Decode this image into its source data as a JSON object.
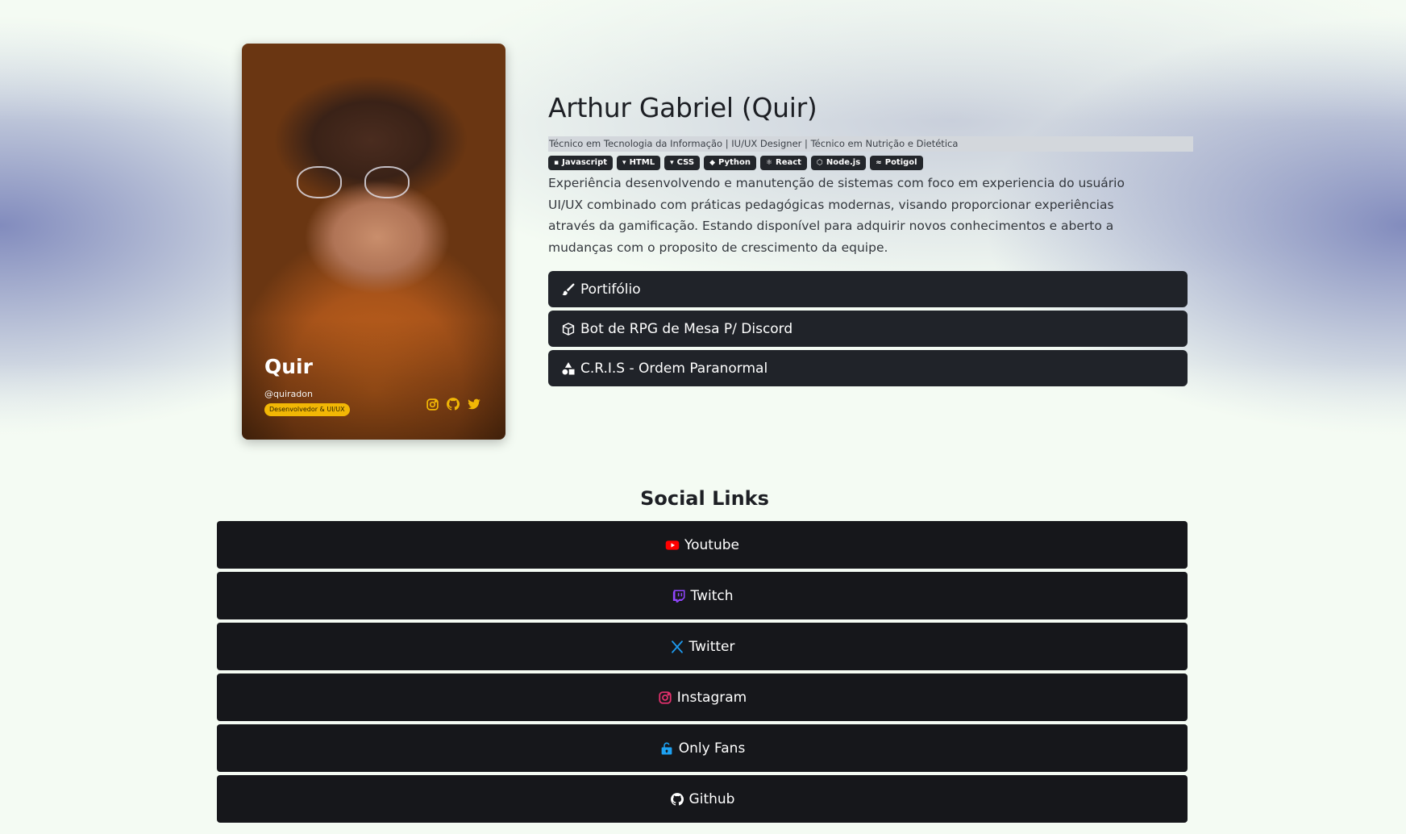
{
  "profile_card": {
    "name": "Quir",
    "handle": "@quiradon",
    "badge": "Desenvolvedor & UI/UX",
    "accent_color": "#f2b705",
    "socials": [
      {
        "icon": "instagram-icon"
      },
      {
        "icon": "github-icon"
      },
      {
        "icon": "twitter-icon"
      }
    ]
  },
  "header": {
    "title": "Arthur Gabriel (Quir)",
    "subtitle": "Técnico em Tecnologia da Informação | IU/UX Designer | Técnico em Nutrição e Dietética"
  },
  "skills": [
    {
      "label": "Javascript",
      "icon": "javascript-icon"
    },
    {
      "label": "HTML",
      "icon": "html-icon"
    },
    {
      "label": "CSS",
      "icon": "css-icon"
    },
    {
      "label": "Python",
      "icon": "python-icon"
    },
    {
      "label": "React",
      "icon": "react-icon"
    },
    {
      "label": "Node.js",
      "icon": "nodejs-icon"
    },
    {
      "label": "Potigol",
      "icon": "potigol-icon"
    }
  ],
  "description": "Experiência desenvolvendo e manutenção de sistemas com foco em experiencia do usuário UI/UX combinado com práticas pedagógicas modernas, visando proporcionar experiências através da gamificação. Estando disponível para adquirir novos conhecimentos e aberto a mudanças com o proposito de crescimento da equipe.",
  "projects": [
    {
      "label": "Portifólio",
      "icon": "brush-icon"
    },
    {
      "label": "Bot de RPG de Mesa P/ Discord",
      "icon": "cube-icon"
    },
    {
      "label": "C.R.I.S - Ordem Paranormal",
      "icon": "shapes-icon"
    }
  ],
  "social_links": {
    "title": "Social Links",
    "items": [
      {
        "label": "Youtube",
        "icon": "youtube-icon",
        "color": "#ff0000"
      },
      {
        "label": "Twitch",
        "icon": "twitch-icon",
        "color": "#9146ff"
      },
      {
        "label": "Twitter",
        "icon": "x-icon",
        "color": "#1d9bf0"
      },
      {
        "label": "Instagram",
        "icon": "instagram-icon",
        "color": "#e1306c"
      },
      {
        "label": "Only Fans",
        "icon": "unlock-icon",
        "color": "#1da1f2"
      },
      {
        "label": "Github",
        "icon": "github-icon",
        "color": "#ffffff"
      }
    ]
  }
}
